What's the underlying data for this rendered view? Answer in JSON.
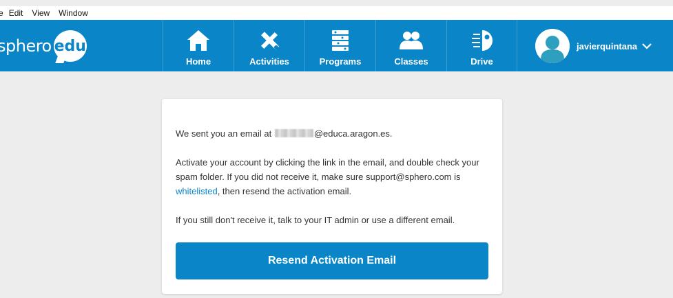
{
  "menubar": {
    "items": [
      "e",
      "Edit",
      "View",
      "Window"
    ]
  },
  "brand": {
    "name": "sphero",
    "edu": "edu",
    "color": "#0a86c8"
  },
  "nav": {
    "items": [
      {
        "label": "Home",
        "icon": "home-icon"
      },
      {
        "label": "Activities",
        "icon": "activities-icon"
      },
      {
        "label": "Programs",
        "icon": "programs-icon"
      },
      {
        "label": "Classes",
        "icon": "classes-icon"
      },
      {
        "label": "Drive",
        "icon": "drive-icon"
      }
    ]
  },
  "user": {
    "name": "javierquintana",
    "icon": "avatar-icon"
  },
  "card": {
    "email_prefix": "We sent you an email at ",
    "email_domain": "@educa.aragon.es.",
    "paragraph2_part1": "Activate your account by clicking the link in the email, and double check your spam folder. If you did not receive it, make sure support@sphero.com is ",
    "whitelisted_link": "whitelisted",
    "paragraph2_part2": ", then resend the activation email.",
    "paragraph3": "If you still don't receive it, talk to your IT admin or use a different email.",
    "resend_button": "Resend Activation Email"
  }
}
